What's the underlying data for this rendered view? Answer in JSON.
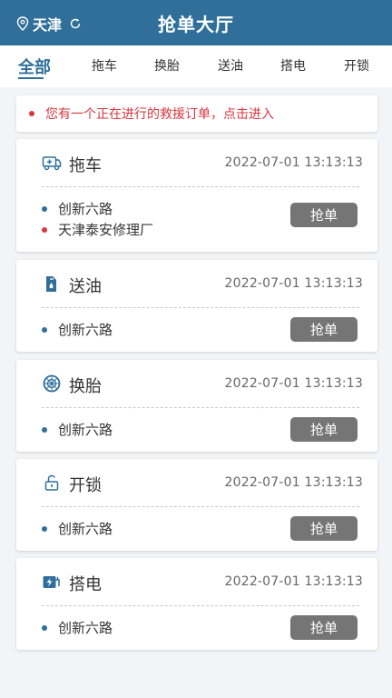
{
  "header": {
    "city": "天津",
    "title": "抢单大厅",
    "bg_color": "#2f6f9a"
  },
  "tabs": [
    {
      "label": "全部",
      "active": true
    },
    {
      "label": "拖车"
    },
    {
      "label": "换胎"
    },
    {
      "label": "送油"
    },
    {
      "label": "搭电"
    },
    {
      "label": "开锁"
    }
  ],
  "notice": {
    "text": "您有一个正在进行的救援订单，点击进入",
    "color": "#d9363e"
  },
  "orders": [
    {
      "type": "拖车",
      "icon": "tow-truck-icon",
      "time": "2022-07-01   13:13:13",
      "addresses": [
        "创新六路",
        "天津泰安修理厂"
      ],
      "button": "抢单"
    },
    {
      "type": "送油",
      "icon": "fuel-can-icon",
      "time": "2022-07-01   13:13:13",
      "addresses": [
        "创新六路"
      ],
      "button": "抢单"
    },
    {
      "type": "换胎",
      "icon": "tire-icon",
      "time": "2022-07-01   13:13:13",
      "addresses": [
        "创新六路"
      ],
      "button": "抢单"
    },
    {
      "type": "开锁",
      "icon": "lock-icon",
      "time": "2022-07-01   13:13:13",
      "addresses": [
        "创新六路"
      ],
      "button": "抢单"
    },
    {
      "type": "搭电",
      "icon": "jump-start-icon",
      "time": "2022-07-01   13:13:13",
      "addresses": [
        "创新六路"
      ],
      "button": "抢单"
    }
  ]
}
